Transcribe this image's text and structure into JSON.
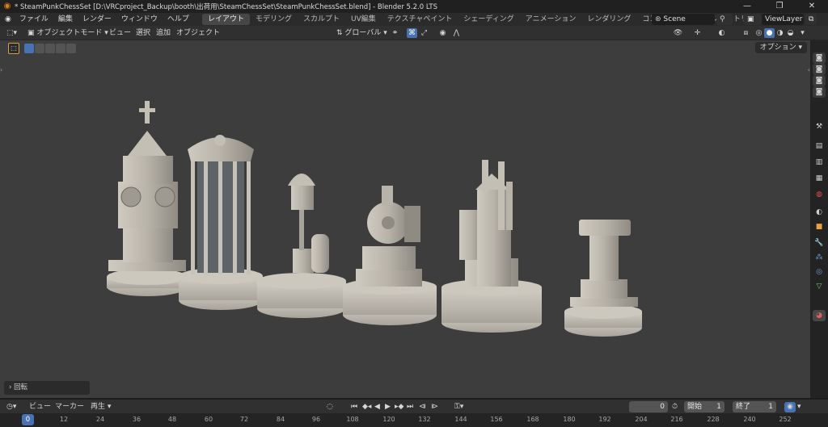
{
  "window": {
    "title": "* SteamPunkChessSet [D:\\VRCproject_Backup\\booth\\出荷用\\SteamChessSet\\SteamPunkChessSet.blend] - Blender 5.2.0 LTS",
    "minimize": "—",
    "maximize": "❐",
    "close": "✕"
  },
  "menu": {
    "items": [
      "ファイル",
      "編集",
      "レンダー",
      "ウィンドウ",
      "ヘルプ"
    ],
    "workspaces": [
      "レイアウト",
      "モデリング",
      "スカルプト",
      "UV編集",
      "テクスチャペイント",
      "シェーディング",
      "アニメーション",
      "レンダリング",
      "コンポジティング",
      "ジオメトリノ"
    ],
    "active_workspace": "レイアウト",
    "scene": "Scene",
    "view_layer": "ViewLayer"
  },
  "header": {
    "mode": "オブジェクトモード",
    "view": "ビュー",
    "select": "選択",
    "add": "追加",
    "object": "オブジェクト",
    "transform": "グローバル"
  },
  "viewport": {
    "options": "オプション",
    "last_operator": "回転"
  },
  "timeline": {
    "view": "ビュー",
    "marker": "マーカー",
    "playback": "再生",
    "current_frame": "0",
    "start_label": "開始",
    "start": "1",
    "end_label": "終了",
    "end": "1",
    "ticks": [
      "0",
      "12",
      "24",
      "36",
      "48",
      "60",
      "72",
      "84",
      "96",
      "108",
      "120",
      "132",
      "144",
      "156",
      "168",
      "180",
      "192",
      "204",
      "216",
      "228",
      "240",
      "252"
    ]
  },
  "colors": {
    "accent": "#4772b3",
    "viewport_bg": "#3d3d3d",
    "model": "#b7b2a8",
    "active_tool_border": "#d7a23a"
  }
}
